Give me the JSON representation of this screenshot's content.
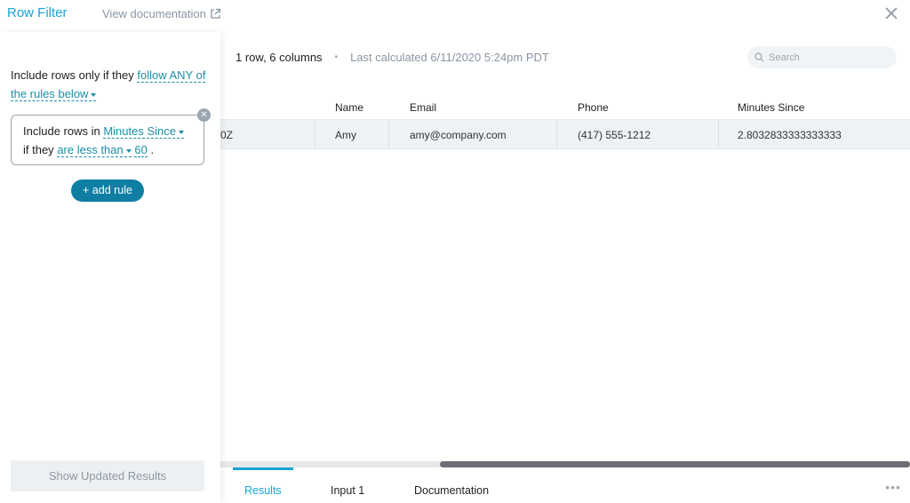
{
  "header": {
    "title": "Row Filter",
    "doc_link": "View documentation"
  },
  "filter": {
    "intro_prefix": "Include rows only if they",
    "mode_dropdown": "follow ANY of the rules below",
    "rule": {
      "prefix": "Include rows in",
      "column": "Minutes Since",
      "mid": "if they",
      "operator": "are less than",
      "value": "60",
      "suffix": "."
    },
    "add_rule": "+ add rule",
    "show_results": "Show Updated Results"
  },
  "results": {
    "row_count": "1 row, 6 columns",
    "separator": "•",
    "last_calculated": "Last calculated 6/11/2020 5:24pm PDT",
    "search_placeholder": "Search",
    "columns": [
      "Name",
      "Email",
      "Phone",
      "Minutes Since"
    ],
    "rows": [
      {
        "partial": "0Z",
        "name": "Amy",
        "email": "amy@company.com",
        "phone": "(417) 555-1212",
        "minutes": "2.8032833333333333"
      }
    ]
  },
  "tabs": {
    "results": "Results",
    "input": "Input 1",
    "documentation": "Documentation",
    "more": "•••"
  },
  "colors": {
    "accent": "#1aa3d6",
    "primary_button": "#0f7ea3",
    "link": "#1a8fa6"
  },
  "icons": {
    "external": "external-link-icon",
    "close": "close-icon",
    "search": "search-icon"
  }
}
